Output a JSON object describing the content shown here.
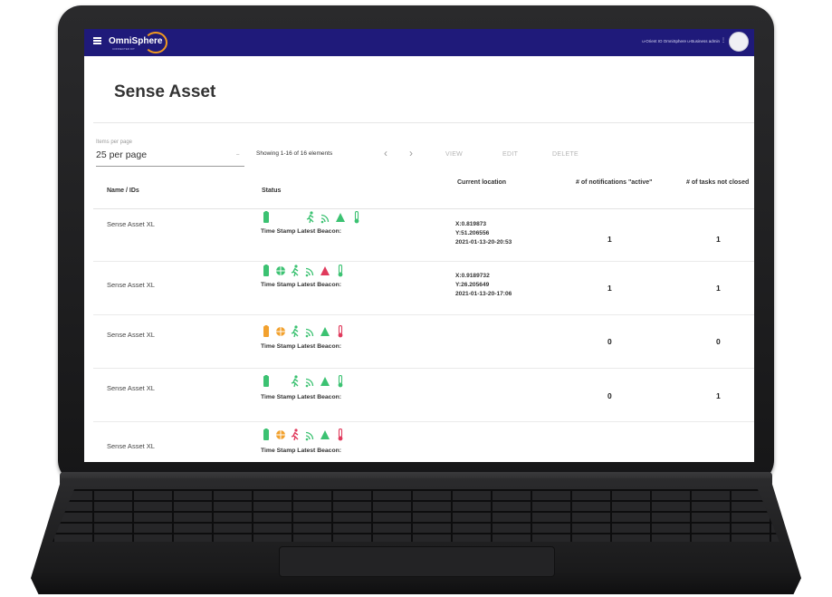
{
  "app": {
    "logo_text": "OmniSphere",
    "logo_subtitle": "CONNECTED IOT",
    "user_text": "u-Orient IO OmniSphere u-Business admin",
    "user_menu_glyph": "⋮"
  },
  "page": {
    "title": "Sense Asset"
  },
  "toolbar": {
    "items_per_page_label": "Items per page",
    "items_per_page_value": "25 per page",
    "showing_text": "Showing 1-16 of 16 elements",
    "prev_glyph": "‹",
    "next_glyph": "›",
    "view_label": "VIEW",
    "edit_label": "EDIT",
    "delete_label": "DELETE"
  },
  "table": {
    "headers": {
      "name": "Name / IDs",
      "status": "Status",
      "location": "Current location",
      "notifications": "# of notifications \"active\"",
      "tasks": "# of tasks not closed"
    },
    "status_caption": "Time Stamp Latest Beacon:",
    "rows": [
      {
        "name": "Sense Asset XL",
        "location": [
          "X:0.819873",
          "Y:51.206556",
          "2021-01-13-20-20:53"
        ],
        "notifications": "1",
        "tasks": "1"
      },
      {
        "name": "Sense Asset XL",
        "location": [
          "X:0.9189732",
          "Y:26.205649",
          "2021-01-13-20-17:06"
        ],
        "notifications": "1",
        "tasks": "1"
      },
      {
        "name": "Sense Asset XL",
        "location": [
          "",
          "",
          ""
        ],
        "notifications": "0",
        "tasks": "0"
      },
      {
        "name": "Sense Asset XL",
        "location": [
          "",
          "",
          ""
        ],
        "notifications": "0",
        "tasks": "1"
      },
      {
        "name": "Sense Asset XL",
        "location": [
          "",
          "",
          ""
        ],
        "notifications": "",
        "tasks": ""
      }
    ]
  },
  "colors": {
    "appbar": "#1f1a7a",
    "ok_green": "#3cc272",
    "warn_orange": "#f2a12e",
    "alert_red": "#e03a5c",
    "logo_ring": "#f29a1f"
  },
  "icon_names": [
    "battery-icon",
    "globe-icon",
    "motion-icon",
    "signal-icon",
    "alert-triangle-icon",
    "temperature-icon"
  ]
}
